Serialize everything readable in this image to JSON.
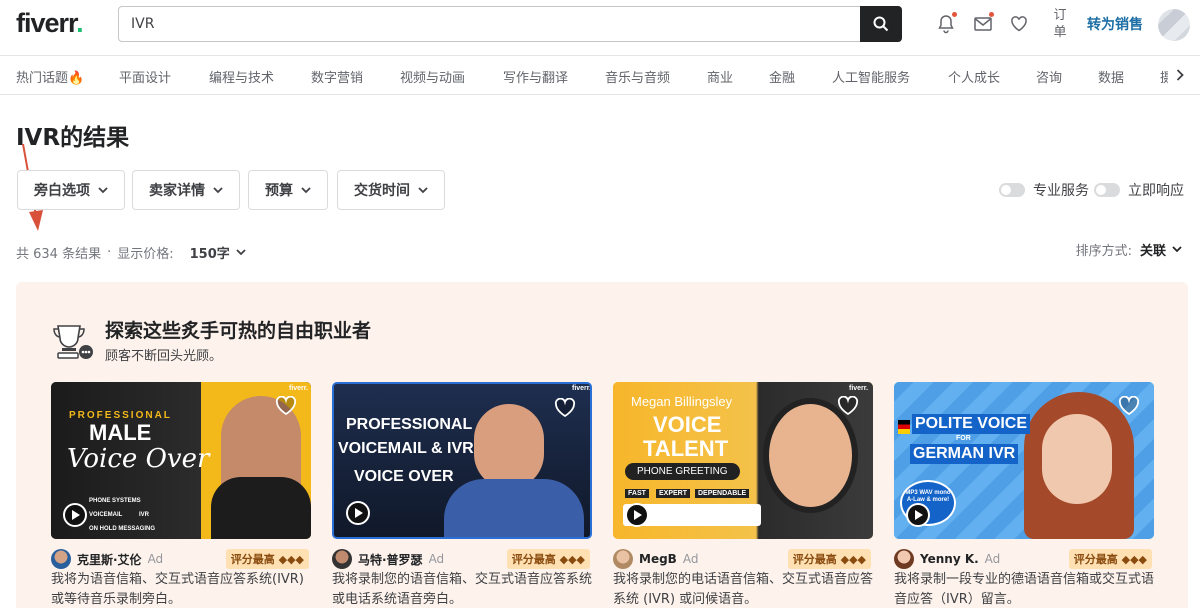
{
  "header": {
    "logo": "fiverr",
    "search_value": "IVR",
    "orders_label": "订单",
    "become_seller": "转为销售"
  },
  "categories": [
    "热门话题🔥",
    "平面设计",
    "编程与技术",
    "数字营销",
    "视频与动画",
    "写作与翻译",
    "音乐与音频",
    "商业",
    "金融",
    "人工智能服务",
    "个人成长",
    "咨询",
    "数据",
    "摄"
  ],
  "page_title": "IVR的结果",
  "filters": [
    "旁白选项",
    "卖家详情",
    "预算",
    "交货时间"
  ],
  "toggles": [
    "专业服务",
    "立即响应"
  ],
  "results": {
    "count_text": "共 634 条结果",
    "separator": "·",
    "price_label": "显示价格:",
    "price_value": "150字"
  },
  "sort": {
    "label": "排序方式:",
    "value": "关联"
  },
  "promo": {
    "title": "探索这些炙手可热的自由职业者",
    "subtitle": "顾客不断回头光顾。"
  },
  "cards": [
    {
      "seller": "克里斯·艾伦",
      "ad": "Ad",
      "badge": "评分最高 ◆◆◆",
      "title": "我将为语音信箱、交互式语音应答系统(IVR) 或等待音乐录制旁白。",
      "thumb": {
        "line1": "PROFESSIONAL",
        "line2": "MALE",
        "line3": "Voice Over",
        "items": [
          "PHONE SYSTEMS",
          "VOICEMAIL",
          "IVR",
          "ON HOLD MESSAGING"
        ],
        "brand": "fiverr."
      }
    },
    {
      "seller": "马特·普罗瑟",
      "ad": "Ad",
      "badge": "评分最高 ◆◆◆",
      "title": "我将录制您的语音信箱、交互式语音应答系统或电话系统语音旁白。",
      "thumb": {
        "line1": "PROFESSIONAL",
        "line2": "VOICEMAIL & IVR",
        "line3": "VOICE OVER",
        "brand": "fiverr."
      }
    },
    {
      "seller": "MegB",
      "ad": "Ad",
      "badge": "评分最高 ◆◆◆",
      "title": "我将录制您的电话语音信箱、交互式语音应答系统 (IVR) 或问候语音。",
      "thumb": {
        "line1": "Megan Billingsley",
        "line2": "VOICE",
        "line3": "TALENT",
        "pill": "PHONE GREETING",
        "tags": [
          "FAST",
          "EXPERT",
          "DEPENDABLE"
        ],
        "brand": "fiverr."
      }
    },
    {
      "seller": "Yenny K.",
      "ad": "Ad",
      "badge": "评分最高 ◆◆◆",
      "title": "我将录制一段专业的德语语音信箱或交互式语音应答（IVR）留言。",
      "thumb": {
        "line1": "POLITE VOICE",
        "line2": "FOR",
        "line3": "GERMAN IVR",
        "sticker": "MP3 WAV mono A-Law & more!"
      }
    }
  ],
  "colors": {
    "brand_green": "#1dbf73",
    "seller_link": "#1d6fa5",
    "badge_bg": "#ffe0b3",
    "annot_arrow": "#d9513a"
  }
}
